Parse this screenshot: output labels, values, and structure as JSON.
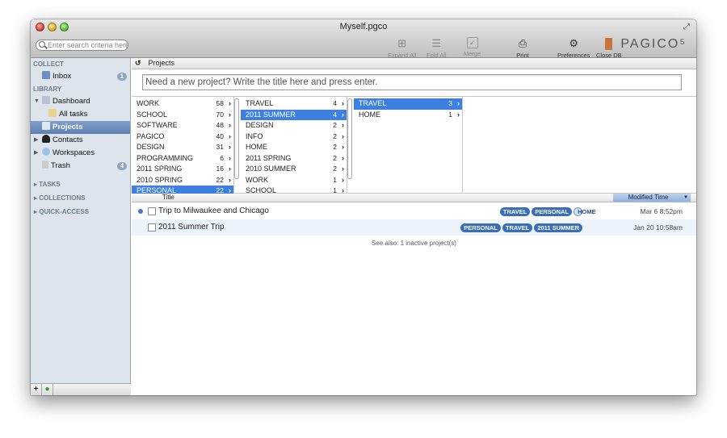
{
  "window": {
    "title": "Myself.pgco"
  },
  "search": {
    "placeholder": "Enter search criteria here"
  },
  "toolbar": {
    "expand_all": "Expand All",
    "fold_all": "Fold All",
    "merge": "Merge",
    "print": "Print",
    "preferences": "Preferences",
    "close_db": "Close DB",
    "logo": "PAGICO⁵"
  },
  "sidebar": {
    "collect_header": "COLLECT",
    "inbox": {
      "label": "Inbox",
      "badge": "1"
    },
    "library_header": "LIBRARY",
    "dashboard": "Dashboard",
    "all_tasks": "All tasks",
    "projects": "Projects",
    "contacts": "Contacts",
    "workspaces": "Workspaces",
    "trash": {
      "label": "Trash",
      "badge": "4"
    },
    "tasks": "TASKS",
    "collections": "COLLECTIONS",
    "quick_access": "QUICK-ACCESS"
  },
  "main": {
    "breadcrumb": "Projects",
    "new_project_placeholder": "Need a new project? Write the title here and press enter."
  },
  "browser": {
    "col1": [
      {
        "label": "WORK",
        "count": "58"
      },
      {
        "label": "SCHOOL",
        "count": "70"
      },
      {
        "label": "SOFTWARE",
        "count": "48"
      },
      {
        "label": "PAGICO",
        "count": "40"
      },
      {
        "label": "DESIGN",
        "count": "31"
      },
      {
        "label": "PROGRAMMING",
        "count": "6"
      },
      {
        "label": "2011 SPRING",
        "count": "16"
      },
      {
        "label": "2010 SPRING",
        "count": "22"
      },
      {
        "label": "PERSONAL",
        "count": "22"
      }
    ],
    "col2": [
      {
        "label": "TRAVEL",
        "count": "4"
      },
      {
        "label": "2011 SUMMER",
        "count": "4"
      },
      {
        "label": "DESIGN",
        "count": "2"
      },
      {
        "label": "INFO",
        "count": "2"
      },
      {
        "label": "HOME",
        "count": "2"
      },
      {
        "label": "2011 SPRING",
        "count": "2"
      },
      {
        "label": "2010 SUMMER",
        "count": "2"
      },
      {
        "label": "WORK",
        "count": "1"
      },
      {
        "label": "SCHOOL",
        "count": "1"
      }
    ],
    "col3": [
      {
        "label": "TRAVEL",
        "count": "3"
      },
      {
        "label": "HOME",
        "count": "1"
      }
    ]
  },
  "list": {
    "col_title": "Title",
    "col_modified": "Modified Time",
    "rows": [
      {
        "name": "Trip to Milwaukee and Chicago",
        "tags": [
          "TRAVEL",
          "PERSONAL",
          "HOME"
        ],
        "date": "Mar 6 8:52pm"
      },
      {
        "name": "2011 Summer Trip",
        "tags": [
          "PERSONAL",
          "TRAVEL",
          "2011 SUMMER"
        ],
        "date": "Jan 20 10:58am"
      }
    ],
    "see_also": "See also: 1 inactive project(s)"
  }
}
